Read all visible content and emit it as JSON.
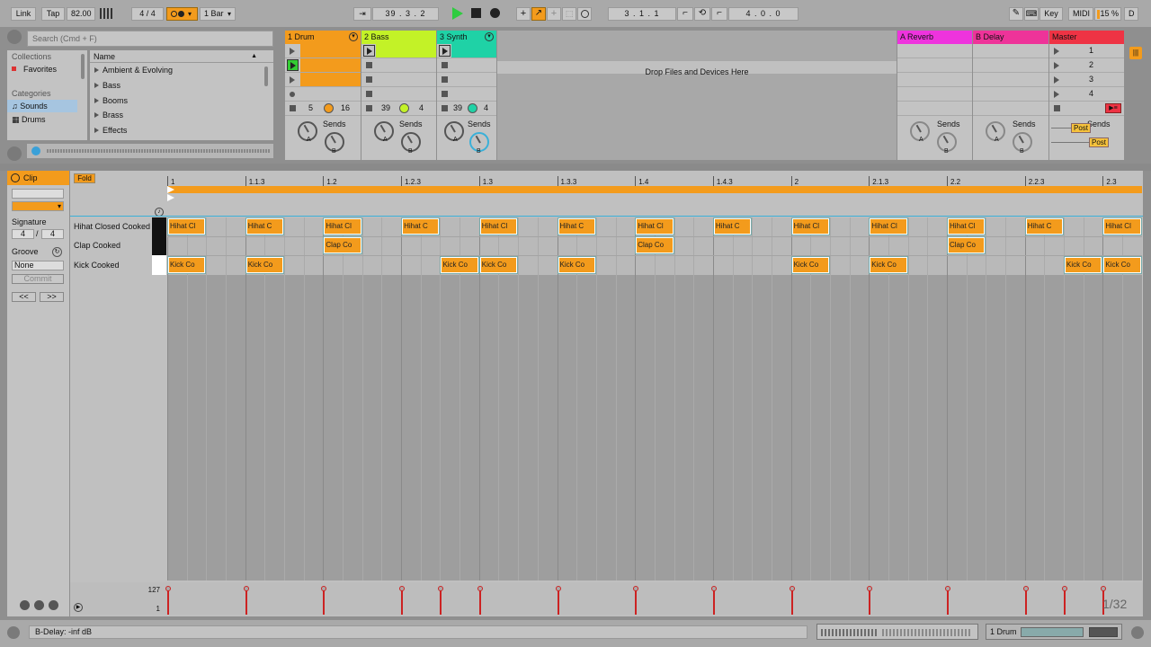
{
  "colors": {
    "orange": "#f39b1c",
    "bass": "#c3f227",
    "synth": "#1fd2a6",
    "reverb": "#ee33dd",
    "delay": "#ee3399",
    "master": "#ee3344",
    "bg": "#8f8f8f",
    "panel": "#c3c3c3"
  },
  "transport": {
    "link": "Link",
    "tap": "Tap",
    "tempo": "82.00",
    "signature": "4 / 4",
    "quantize": "1 Bar",
    "position": "39 . 3 . 2",
    "loop_start": "3 . 1 . 1",
    "loop_length": "4 . 0 . 0",
    "key": "Key",
    "midi": "MIDI",
    "cpu": "15 %",
    "d": "D"
  },
  "browser": {
    "search_placeholder": "Search (Cmd + F)",
    "collections_label": "Collections",
    "favorites": "Favorites",
    "categories_label": "Categories",
    "sounds": "Sounds",
    "drums": "Drums",
    "name_header": "Name",
    "items": [
      "Ambient & Evolving",
      "Bass",
      "Booms",
      "Brass",
      "Effects"
    ]
  },
  "tracks": {
    "drum": {
      "name": "1 Drum",
      "num1": "5",
      "num2": "16",
      "sends": "Sends"
    },
    "bass": {
      "name": "2 Bass",
      "num1": "39",
      "num2": "4",
      "sends": "Sends"
    },
    "synth": {
      "name": "3 Synth",
      "num1": "39",
      "num2": "4",
      "sends": "Sends"
    },
    "drop_text": "Drop Files and Devices Here",
    "reverb": {
      "name": "A Reverb",
      "sends": "Sends"
    },
    "delay": {
      "name": "B Delay",
      "sends": "Sends"
    },
    "master": {
      "name": "Master",
      "sends": "Sends",
      "scenes": [
        "1",
        "2",
        "3",
        "4"
      ],
      "post1": "Post",
      "post2": "Post"
    },
    "knob_a": "A",
    "knob_b": "B"
  },
  "clip": {
    "title": "Clip",
    "signature_label": "Signature",
    "sig_num": "4",
    "sig_den": "4",
    "groove_label": "Groove",
    "groove_value": "None",
    "commit": "Commit",
    "prev": "<<",
    "next": ">>",
    "fold": "Fold"
  },
  "ruler": [
    "1",
    "1.1.3",
    "1.2",
    "1.2.3",
    "1.3",
    "1.3.3",
    "1.4",
    "1.4.3",
    "2",
    "2.1.3",
    "2.2",
    "2.2.3",
    "2.3"
  ],
  "lanes": {
    "hihat": "Hihat Closed Cooked",
    "clap": "Clap Cooked",
    "kick": "Kick Cooked"
  },
  "notes": {
    "hihat_a": "Hihat Cl",
    "hihat_b": "Hihat C",
    "clap": "Clap Co",
    "kick": "Kick Co"
  },
  "velocity": {
    "max": "127",
    "min": "1"
  },
  "grid_label": "1/32",
  "status": {
    "text": "B-Delay: -inf dB",
    "track": "1 Drum"
  }
}
